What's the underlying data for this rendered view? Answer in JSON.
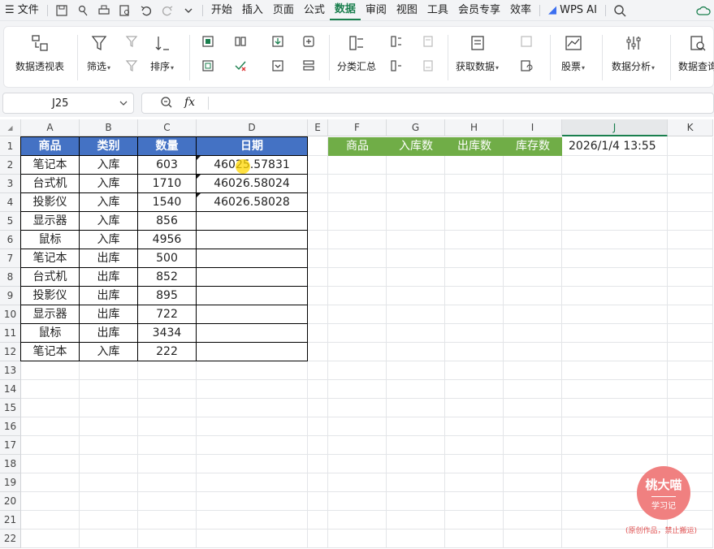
{
  "menubar": {
    "file_label": "文件",
    "tabs": [
      {
        "label": "开始"
      },
      {
        "label": "插入"
      },
      {
        "label": "页面"
      },
      {
        "label": "公式"
      },
      {
        "label": "数据"
      },
      {
        "label": "审阅"
      },
      {
        "label": "视图"
      },
      {
        "label": "工具"
      },
      {
        "label": "会员专享"
      },
      {
        "label": "效率"
      }
    ],
    "active_tab": "数据",
    "wps_ai": "WPS AI"
  },
  "ribbon": {
    "pivot_table": "数据透视表",
    "filter": "筛选",
    "sort": "排序",
    "subtotal": "分类汇总",
    "get_data": "获取数据",
    "stocks": "股票",
    "data_analysis": "数据分析",
    "data_query": "数据查询"
  },
  "formula_bar": {
    "cell_ref": "J25",
    "fx_label": "fx",
    "formula": ""
  },
  "columns": [
    "A",
    "B",
    "C",
    "D",
    "E",
    "F",
    "G",
    "H",
    "I",
    "J",
    "K"
  ],
  "rows": [
    "1",
    "2",
    "3",
    "4",
    "5",
    "6",
    "7",
    "8",
    "9",
    "10",
    "11",
    "12",
    "13",
    "14",
    "15",
    "16",
    "17",
    "18",
    "19",
    "20",
    "21",
    "22"
  ],
  "table": {
    "headers": [
      "商品",
      "类别",
      "数量",
      "日期"
    ],
    "rows": [
      [
        "笔记本",
        "入库",
        "603",
        "46025.57831"
      ],
      [
        "台式机",
        "入库",
        "1710",
        "46026.58024"
      ],
      [
        "投影仪",
        "入库",
        "1540",
        "46026.58028"
      ],
      [
        "显示器",
        "入库",
        "856",
        ""
      ],
      [
        "鼠标",
        "入库",
        "4956",
        ""
      ],
      [
        "笔记本",
        "出库",
        "500",
        ""
      ],
      [
        "台式机",
        "出库",
        "852",
        ""
      ],
      [
        "投影仪",
        "出库",
        "895",
        ""
      ],
      [
        "显示器",
        "出库",
        "722",
        ""
      ],
      [
        "鼠标",
        "出库",
        "3434",
        ""
      ],
      [
        "笔记本",
        "入库",
        "222",
        ""
      ]
    ]
  },
  "summary": {
    "headers": [
      "商品",
      "入库数",
      "出库数",
      "库存数"
    ],
    "datetime": "2026/1/4 13:55"
  },
  "watermark": {
    "name": "桃大喵",
    "sub": "学习记",
    "note": "(原创作品，禁止搬运)"
  },
  "colors": {
    "table_header": "#4472c4",
    "summary_header": "#70ad47",
    "active_tab": "#1a7f4e",
    "watermark": "#f08080"
  }
}
